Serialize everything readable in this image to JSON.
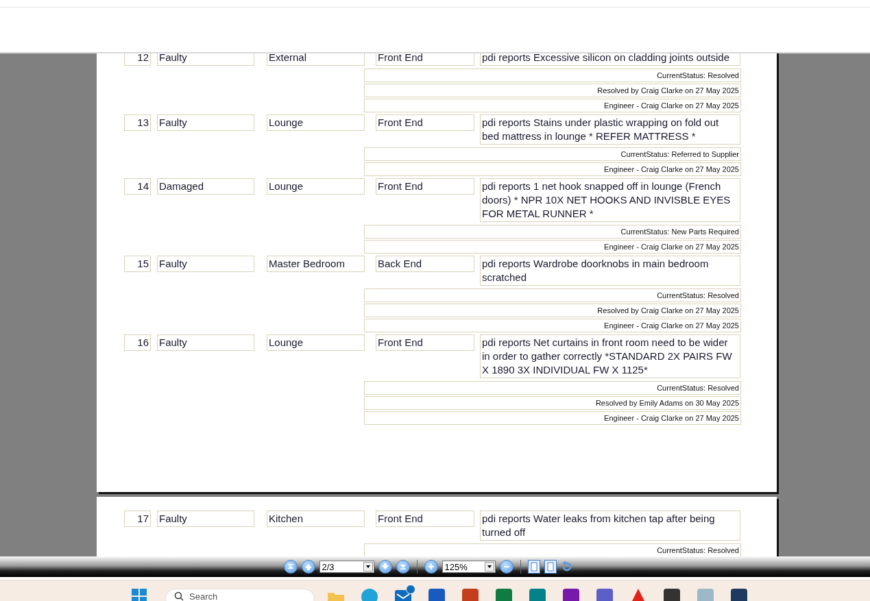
{
  "pages": [
    {
      "entries": [
        {
          "number": "12",
          "type": "Faulty",
          "location": "External",
          "end": "Front End",
          "description": "pdi reports Excessive silicon on cladding joints outside",
          "notes": [
            "CurrentStatus: Resolved",
            "Resolved by Craig Clarke on 27 May 2025",
            "Engineer - Craig Clarke on 27 May 2025"
          ]
        },
        {
          "number": "13",
          "type": "Faulty",
          "location": "Lounge",
          "end": "Front End",
          "description": "pdi reports Stains under plastic wrapping on fold out bed mattress in lounge * REFER MATTRESS *",
          "notes": [
            "CurrentStatus: Referred to Supplier",
            "Engineer - Craig Clarke on 27 May 2025"
          ]
        },
        {
          "number": "14",
          "type": "Damaged",
          "location": "Lounge",
          "end": "Front End",
          "description": "pdi reports 1 net hook snapped off in lounge (French doors) * NPR 10X NET HOOKS AND INVISBLE EYES FOR METAL RUNNER *",
          "notes": [
            "CurrentStatus: New Parts Required",
            "Engineer - Craig Clarke on 27 May 2025"
          ]
        },
        {
          "number": "15",
          "type": "Faulty",
          "location": "Master Bedroom",
          "end": "Back End",
          "description": "pdi reports Wardrobe doorknobs in main bedroom scratched",
          "notes": [
            "CurrentStatus: Resolved",
            "Resolved by Craig Clarke on 27 May 2025",
            "Engineer - Craig Clarke on 27 May 2025"
          ]
        },
        {
          "number": "16",
          "type": "Faulty",
          "location": "Lounge",
          "end": "Front End",
          "description": "pdi reports Net curtains in front room need to be wider in order to gather correctly *STANDARD 2X PAIRS FW X 1890 3X INDIVIDUAL FW X 1125*",
          "notes": [
            "CurrentStatus: Resolved",
            "Resolved by Emily Adams on 30 May 2025",
            "Engineer - Craig Clarke on 27 May 2025"
          ]
        }
      ]
    },
    {
      "entries": [
        {
          "number": "17",
          "type": "Faulty",
          "location": "Kitchen",
          "end": "Front End",
          "description": "pdi reports Water leaks from kitchen tap after being turned off",
          "notes": [
            "CurrentStatus: Resolved"
          ]
        }
      ]
    }
  ],
  "toolbar": {
    "page": "2/3",
    "zoom": "125%"
  },
  "taskbar": {
    "search_placeholder": "Search",
    "apps": [
      {
        "kind": "folder",
        "color": "#f2c14e"
      },
      {
        "kind": "browser",
        "color": "#1fa3d8"
      },
      {
        "kind": "mail",
        "color": "#0f6cbd",
        "badge": true
      },
      {
        "kind": "app",
        "color": "#185abd"
      },
      {
        "kind": "app",
        "color": "#c43e1c"
      },
      {
        "kind": "app",
        "color": "#107c41"
      },
      {
        "kind": "app",
        "color": "#038387"
      },
      {
        "kind": "app",
        "color": "#7719aa"
      },
      {
        "kind": "app",
        "color": "#5b5fc7"
      },
      {
        "kind": "pdf",
        "color": "#e2231a"
      },
      {
        "kind": "app",
        "color": "#333333"
      },
      {
        "kind": "app",
        "color": "#9fb8c8"
      },
      {
        "kind": "app",
        "color": "#1e3a5f"
      }
    ]
  }
}
